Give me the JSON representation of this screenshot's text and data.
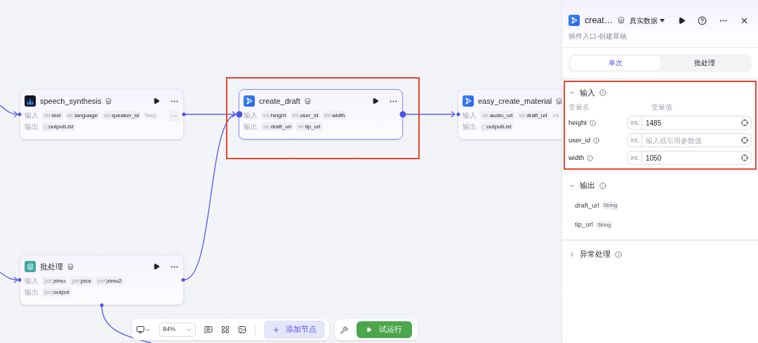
{
  "nodes": [
    {
      "title": "speech_synthesis",
      "selected": false,
      "input_label": "输入",
      "output_label": "输出",
      "inputs": [
        {
          "kind": "param",
          "type": "str.",
          "name": "text"
        },
        {
          "kind": "param",
          "type": "str.",
          "name": "language"
        },
        {
          "kind": "param",
          "type": "str.",
          "name": "speaker_id"
        },
        {
          "kind": "faded",
          "type": "№",
          "name": "sp"
        },
        {
          "kind": "more",
          "name": "···"
        }
      ],
      "outputs": [
        {
          "kind": "param",
          "type": "[ ]",
          "name": "outputList"
        }
      ]
    },
    {
      "title": "create_draft",
      "selected": true,
      "input_label": "输入",
      "output_label": "输出",
      "inputs": [
        {
          "kind": "param",
          "type": "int.",
          "name": "height"
        },
        {
          "kind": "param",
          "type": "int.",
          "name": "user_id"
        },
        {
          "kind": "param",
          "type": "int.",
          "name": "width"
        }
      ],
      "outputs": [
        {
          "kind": "param",
          "type": "str.",
          "name": "draft_url"
        },
        {
          "kind": "param",
          "type": "str.",
          "name": "tip_url"
        }
      ]
    },
    {
      "title": "easy_create_material",
      "selected": false,
      "input_label": "输入",
      "output_label": "输出",
      "inputs": [
        {
          "kind": "param",
          "type": "str.",
          "name": "audio_url"
        },
        {
          "kind": "param",
          "type": "str.",
          "name": "draft_url"
        },
        {
          "kind": "faded",
          "type": "int."
        }
      ],
      "outputs": [
        {
          "kind": "param",
          "type": "[ ]",
          "name": "outputList"
        }
      ]
    },
    {
      "title": "批处理",
      "selected": false,
      "input_label": "输入",
      "output_label": "输出",
      "inputs": [
        {
          "kind": "param",
          "type": "[str]",
          "name": "zimu"
        },
        {
          "kind": "param",
          "type": "[str]",
          "name": "pics"
        },
        {
          "kind": "param",
          "type": "[str]",
          "name": "zimu2"
        }
      ],
      "outputs": [
        {
          "kind": "param",
          "type": "[str]",
          "name": "output"
        }
      ]
    }
  ],
  "panel": {
    "title": "creat…",
    "data_mode": "真实数据",
    "subtitle": "插件入口-创建草稿",
    "tabs": [
      {
        "label": "单次",
        "selected": true
      },
      {
        "label": "批处理",
        "selected": false
      }
    ],
    "input_section": {
      "title": "输入",
      "expanded": true,
      "col_name": "变量名",
      "col_value": "变量值",
      "rows": [
        {
          "name": "height",
          "type": "int.",
          "value": "1485"
        },
        {
          "name": "user_id",
          "type": "int.",
          "placeholder": "输入或引用参数值"
        },
        {
          "name": "width",
          "type": "int.",
          "value": "1050"
        }
      ]
    },
    "output_section": {
      "title": "输出",
      "expanded": true,
      "rows": [
        {
          "name": "draft_url",
          "type": "String"
        },
        {
          "name": "tip_url",
          "type": "String"
        }
      ]
    },
    "error_section": {
      "title": "异常处理",
      "expanded": false
    }
  },
  "toolbar": {
    "zoom": "84%",
    "add_node": "添加节点",
    "run": "试运行"
  }
}
